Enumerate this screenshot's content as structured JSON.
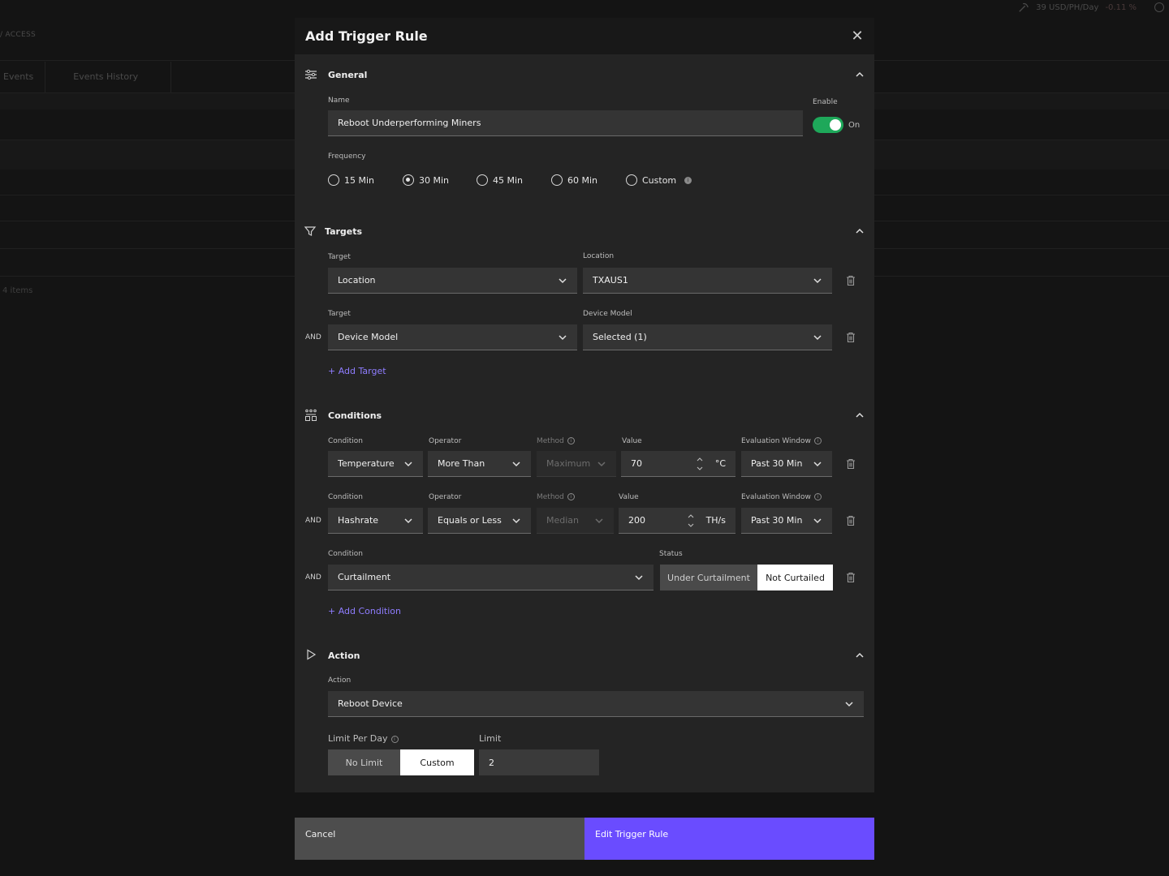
{
  "background": {
    "top_stats": {
      "price": "39 USD/PH/Day",
      "change": "-0.11 %"
    },
    "access_label": "/ ACCESS",
    "tabs": [
      "Events",
      "Events History"
    ],
    "items_label": "4 items"
  },
  "modal": {
    "title": "Add Trigger Rule",
    "general": {
      "title": "General",
      "name_label": "Name",
      "name_value": "Reboot Underperforming Miners",
      "enable_label": "Enable",
      "enable_state": "On",
      "frequency_label": "Frequency",
      "frequency_options": [
        "15 Min",
        "30 Min",
        "45 Min",
        "60 Min",
        "Custom"
      ],
      "frequency_selected": "30 Min"
    },
    "targets": {
      "title": "Targets",
      "rows": [
        {
          "target_label": "Target",
          "target_value": "Location",
          "value_label": "Location",
          "value": "TXAUS1"
        },
        {
          "connector": "AND",
          "target_label": "Target",
          "target_value": "Device Model",
          "value_label": "Device Model",
          "value": "Selected (1)"
        }
      ],
      "add_label": "+ Add Target"
    },
    "conditions": {
      "title": "Conditions",
      "rows": [
        {
          "condition_label": "Condition",
          "condition": "Temperature",
          "operator_label": "Operator",
          "operator": "More Than",
          "method_label": "Method",
          "method": "Maximum",
          "value_label": "Value",
          "value": "70",
          "unit": "°C",
          "window_label": "Evaluation Window",
          "window": "Past 30 Min"
        },
        {
          "connector": "AND",
          "condition_label": "Condition",
          "condition": "Hashrate",
          "operator_label": "Operator",
          "operator": "Equals or Less",
          "method_label": "Method",
          "method": "Median",
          "value_label": "Value",
          "value": "200",
          "unit": "TH/s",
          "window_label": "Evaluation Window",
          "window": "Past 30 Min"
        }
      ],
      "curtailment": {
        "connector": "AND",
        "condition_label": "Condition",
        "condition": "Curtailment",
        "status_label": "Status",
        "options": [
          "Under Curtailment",
          "Not Curtailed"
        ],
        "selected": "Not Curtailed"
      },
      "add_label": "+ Add Condition"
    },
    "action": {
      "title": "Action",
      "action_label": "Action",
      "action_value": "Reboot Device",
      "limit_per_day_label": "Limit Per Day",
      "limit_options": [
        "No Limit",
        "Custom"
      ],
      "limit_selected": "Custom",
      "limit_label": "Limit",
      "limit_value": "2"
    },
    "footer": {
      "cancel_label": "Cancel",
      "submit_label": "Edit Trigger Rule"
    }
  }
}
